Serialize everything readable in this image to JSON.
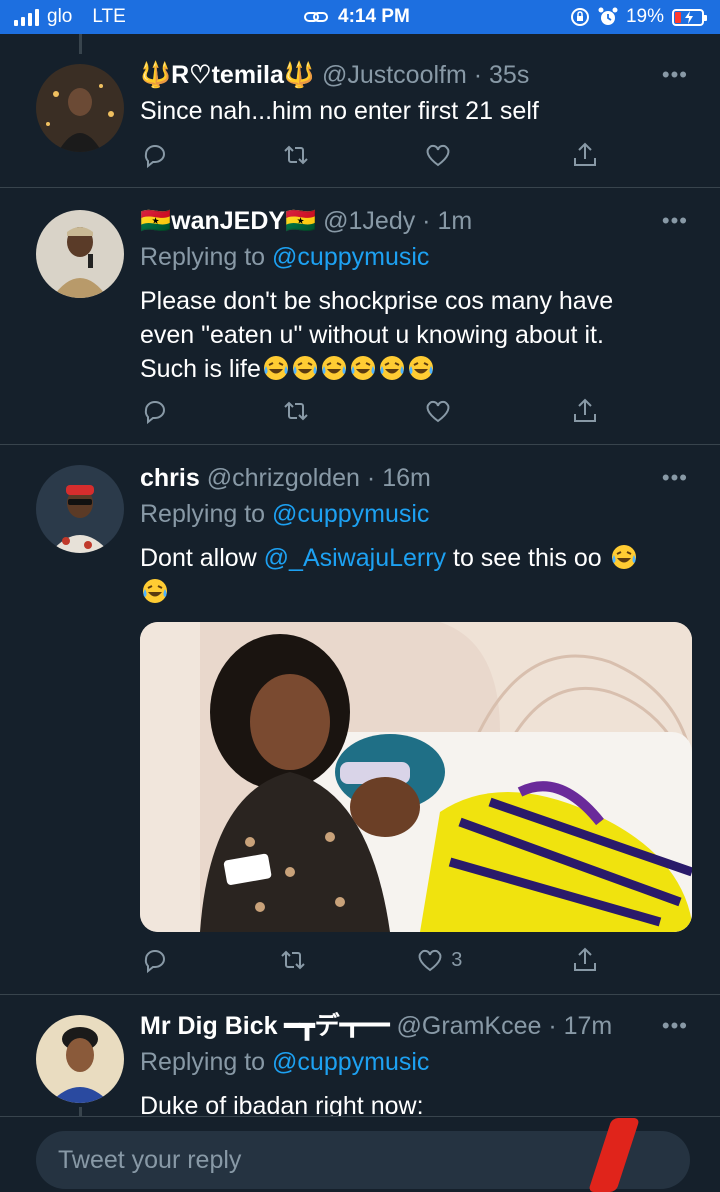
{
  "status_bar": {
    "carrier": "glo",
    "network": "LTE",
    "time": "4:14 PM",
    "battery": "19%"
  },
  "tweets": [
    {
      "name": "🔱R♡temila🔱",
      "handle": "@Justcoolfm",
      "time": "35s",
      "replying_prefix": "",
      "replying_to": "",
      "text": "Since nah...him no enter first 21 self",
      "likes": ""
    },
    {
      "name": "🇬🇭wanJEDY🇬🇭",
      "handle": "@1Jedy",
      "time": "1m",
      "replying_prefix": "Replying to ",
      "replying_to": "@cuppymusic",
      "text_line1": "Please don't be shockprise cos many have",
      "text_line2": "even \"eaten u\" without u knowing about it.",
      "text_line3": "Such is life",
      "likes": ""
    },
    {
      "name": "chris",
      "handle": "@chrizgolden",
      "time": "16m",
      "replying_prefix": "Replying to ",
      "replying_to": "@cuppymusic",
      "text_pre": "Dont allow ",
      "text_mention": "@_AsiwajuLerry",
      "text_post": " to  see this oo ",
      "likes": "3"
    },
    {
      "name": "Mr Dig Bick ━┳デ┳━",
      "handle": "@GramKcee",
      "time": "17m",
      "replying_prefix": "Replying to ",
      "replying_to": "@cuppymusic",
      "text": "Duke of ibadan right now:",
      "likes": ""
    }
  ],
  "more_label": "•••",
  "separator": " · ",
  "reply_bar": {
    "placeholder": "Tweet your reply"
  },
  "colors": {
    "background": "#15202b",
    "accent": "#1da1f2",
    "muted": "#8899a6",
    "status_bar": "#1d6fe0"
  }
}
